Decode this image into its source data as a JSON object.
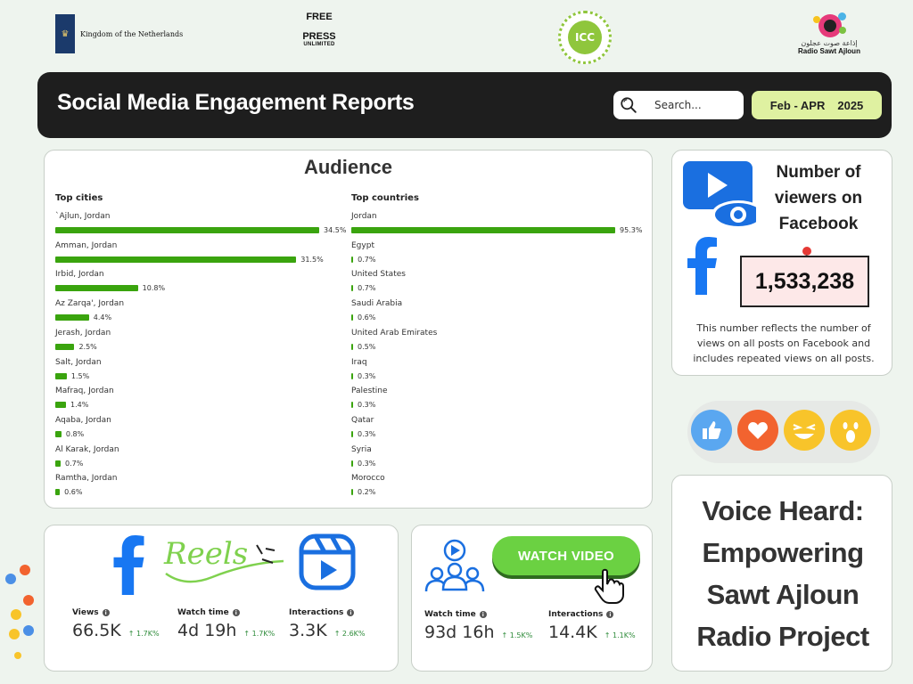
{
  "logos": {
    "netherlands": "Kingdom of the Netherlands",
    "fpu_top": "FREE",
    "fpu_mid": "PRESS",
    "fpu_bottom": "UNLIMITED",
    "icc": "ICC",
    "radio_ar": "إذاعة صوت عجلون",
    "radio_name": "Radio Sawt Ajloun"
  },
  "header": {
    "title": "Social Media Engagement Reports",
    "search_placeholder": "Search...",
    "date_range": "Feb - APR",
    "year": "2025"
  },
  "audience": {
    "title": "Audience",
    "cities_title": "Top cities",
    "countries_title": "Top countries",
    "cities": [
      {
        "label": "`Ajlun, Jordan",
        "value": 34.5,
        "display": "34.5%"
      },
      {
        "label": "Amman, Jordan",
        "value": 31.5,
        "display": "31.5%"
      },
      {
        "label": "Irbid, Jordan",
        "value": 10.8,
        "display": "10.8%"
      },
      {
        "label": "Az Zarqa', Jordan",
        "value": 4.4,
        "display": "4.4%"
      },
      {
        "label": "Jerash, Jordan",
        "value": 2.5,
        "display": "2.5%"
      },
      {
        "label": "Salt, Jordan",
        "value": 1.5,
        "display": "1.5%"
      },
      {
        "label": "Mafraq, Jordan",
        "value": 1.4,
        "display": "1.4%"
      },
      {
        "label": "Aqaba, Jordan",
        "value": 0.8,
        "display": "0.8%"
      },
      {
        "label": "Al Karak, Jordan",
        "value": 0.7,
        "display": "0.7%"
      },
      {
        "label": "Ramtha, Jordan",
        "value": 0.6,
        "display": "0.6%"
      }
    ],
    "countries": [
      {
        "label": "Jordan",
        "value": 95.3,
        "display": "95.3%"
      },
      {
        "label": "Egypt",
        "value": 0.7,
        "display": "0.7%"
      },
      {
        "label": "United States",
        "value": 0.7,
        "display": "0.7%"
      },
      {
        "label": "Saudi Arabia",
        "value": 0.6,
        "display": "0.6%"
      },
      {
        "label": "United Arab Emirates",
        "value": 0.5,
        "display": "0.5%"
      },
      {
        "label": "Iraq",
        "value": 0.3,
        "display": "0.3%"
      },
      {
        "label": "Palestine",
        "value": 0.3,
        "display": "0.3%"
      },
      {
        "label": "Qatar",
        "value": 0.3,
        "display": "0.3%"
      },
      {
        "label": "Syria",
        "value": 0.3,
        "display": "0.3%"
      },
      {
        "label": "Morocco",
        "value": 0.2,
        "display": "0.2%"
      }
    ]
  },
  "fb_viewers": {
    "title_line1": "Number of",
    "title_line2": "viewers on",
    "title_line3": "Facebook",
    "number": "1,533,238",
    "note": "This number reflects the number of views on all posts on Facebook and includes repeated views on all posts."
  },
  "fb_stats": {
    "reels_text": "Reels",
    "views_label": "Views",
    "views_value": "66.5K",
    "views_trend": "↑ 1.7K%",
    "watch_label": "Watch time",
    "watch_value": "4d 19h",
    "watch_trend": "↑ 1.7K%",
    "interactions_label": "Interactions",
    "interactions_value": "3.3K",
    "interactions_trend": "↑ 2.6K%"
  },
  "video_stats": {
    "button": "WATCH VIDEO",
    "watch_label": "Watch time",
    "watch_value": "93d 16h",
    "watch_trend": "↑ 1.5K%",
    "interactions_label": "Interactions",
    "interactions_value": "14.4K",
    "interactions_trend": "↑ 1.1K%"
  },
  "voice": {
    "line1": "Voice Heard:",
    "line2": "Empowering",
    "line3": "Sawt Ajloun",
    "line4": "Radio Project"
  },
  "colors": {
    "bar": "#3aa40e",
    "facebook": "#1877f2",
    "header": "#1e1e1e",
    "date_pill": "#dff1a1",
    "watch_button": "#6bd142"
  }
}
